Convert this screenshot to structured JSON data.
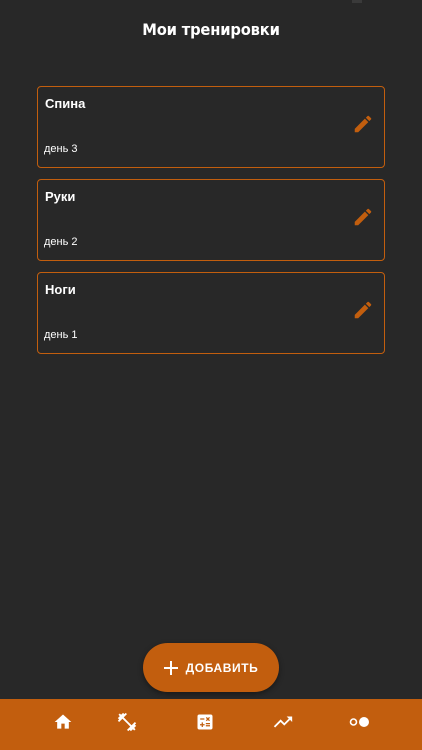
{
  "screen": {
    "title": "Мои тренировки"
  },
  "workouts": [
    {
      "name": "Спина",
      "day": "день 3"
    },
    {
      "name": "Руки",
      "day": "день 2"
    },
    {
      "name": "Ноги",
      "day": "день 1"
    }
  ],
  "add_button": {
    "label": "ДОБАВИТЬ",
    "icon": "plus-icon"
  },
  "bottom_nav": {
    "items": [
      {
        "icon": "home-icon"
      },
      {
        "icon": "fitness-icon"
      },
      {
        "icon": "calculator-icon"
      },
      {
        "icon": "trending-up-icon"
      },
      {
        "icon": "toggle-icon"
      }
    ]
  },
  "colors": {
    "background": "#282828",
    "accent": "#c25e0e",
    "text": "#ffffff"
  }
}
